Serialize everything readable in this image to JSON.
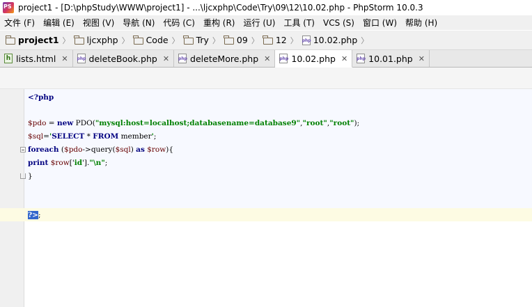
{
  "window": {
    "title": "project1 - [D:\\phpStudy\\WWW\\project1] - ...\\ljcxphp\\Code\\Try\\09\\12\\10.02.php - PhpStorm 10.0.3"
  },
  "menu": {
    "items": [
      "文件 (F)",
      "编辑 (E)",
      "视图 (V)",
      "导航 (N)",
      "代码 (C)",
      "重构 (R)",
      "运行 (U)",
      "工具 (T)",
      "VCS (S)",
      "窗口 (W)",
      "帮助 (H)"
    ]
  },
  "breadcrumb": {
    "items": [
      {
        "label": "project1",
        "icon": "folder-icon"
      },
      {
        "label": "ljcxphp",
        "icon": "folder-icon"
      },
      {
        "label": "Code",
        "icon": "folder-icon"
      },
      {
        "label": "Try",
        "icon": "folder-icon"
      },
      {
        "label": "09",
        "icon": "folder-icon"
      },
      {
        "label": "12",
        "icon": "folder-icon"
      },
      {
        "label": "10.02.php",
        "icon": "php-file-icon"
      }
    ]
  },
  "tabs": [
    {
      "label": "lists.html",
      "icon": "html-file-icon",
      "active": false
    },
    {
      "label": "deleteBook.php",
      "icon": "php-file-icon",
      "active": false
    },
    {
      "label": "deleteMore.php",
      "icon": "php-file-icon",
      "active": false
    },
    {
      "label": "10.02.php",
      "icon": "php-file-icon",
      "active": true
    },
    {
      "label": "10.01.php",
      "icon": "php-file-icon",
      "active": false
    }
  ],
  "tab_close_glyph": "✕",
  "editor": {
    "open_tag": "<?php",
    "close_tag": "?>",
    "close_tag_suffix": ";",
    "line_pdo": {
      "var": "$pdo",
      "assign": " = ",
      "new_kw": "new",
      "class_call": " PDO(",
      "dsn": "\"mysql:host=localhost;databasename=database9\"",
      "comma1": ",",
      "user": "\"root\"",
      "comma2": ",",
      "pass": "\"root\"",
      "end": ");"
    },
    "line_sql": {
      "var": "$sql",
      "assign": "=",
      "quote_open": "'",
      "select_kw": "SELECT",
      "star": " * ",
      "from_kw": "FROM",
      "table": " member",
      "quote_close": "'",
      "end": ";"
    },
    "line_foreach": {
      "kw": "foreach",
      "open": " (",
      "var": "$pdo",
      "method": "->query(",
      "arg": "$sql",
      "close": ") ",
      "as_kw": "as",
      "space": " ",
      "row": "$row",
      "brace": "){"
    },
    "line_print": {
      "kw": "print",
      "space": " ",
      "row": "$row",
      "idx_open": "['",
      "key": "id",
      "idx_close": "'].",
      "newline_str": "\"\\n\"",
      "end": ";"
    },
    "close_brace": "}"
  },
  "colors": {
    "keyword": "#000080",
    "variable": "#660000",
    "string": "#008000",
    "caret_line": "#fdfbe3",
    "selection": "#3366cc"
  }
}
